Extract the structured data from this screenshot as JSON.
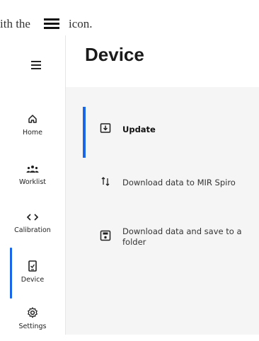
{
  "doc_text": {
    "before_icon": "ith the",
    "after_icon": "icon."
  },
  "sidebar": {
    "items": [
      {
        "label": "Home",
        "icon": "home-icon"
      },
      {
        "label": "Worklist",
        "icon": "people-icon"
      },
      {
        "label": "Calibration",
        "icon": "code-icon"
      },
      {
        "label": "Device",
        "icon": "device-icon",
        "active": true
      },
      {
        "label": "Settings",
        "icon": "gear-icon"
      }
    ]
  },
  "main": {
    "title": "Device",
    "actions": [
      {
        "label": "Update",
        "icon": "download-box-icon",
        "active": true
      },
      {
        "label": "Download data to MIR Spiro",
        "icon": "transfer-arrows-icon"
      },
      {
        "label": "Download data and save to a folder",
        "icon": "save-icon"
      }
    ]
  },
  "colors": {
    "accent": "#1a66e8",
    "panel": "#f5f5f5"
  }
}
